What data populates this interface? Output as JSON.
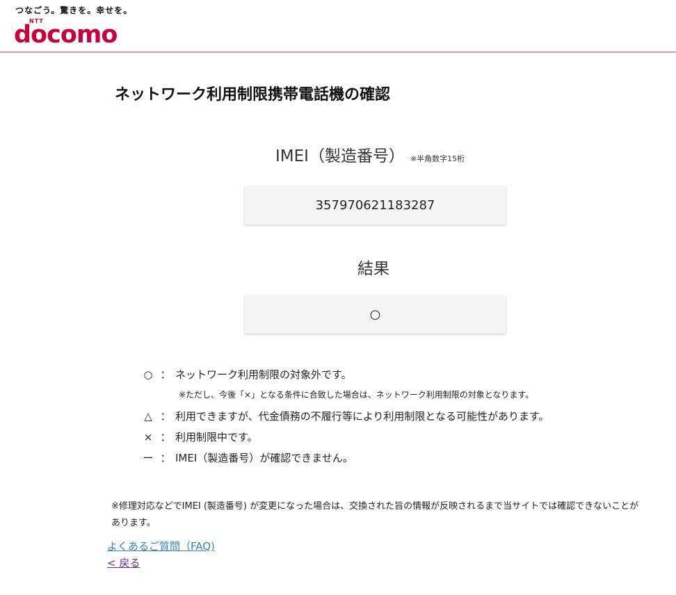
{
  "header": {
    "tagline": "つなごう。驚きを。幸せを。",
    "logo_ntt": "NTT",
    "logo_word": "docomo",
    "brand_color": "#c8003c"
  },
  "page": {
    "title": "ネットワーク利用制限携帯電話機の確認"
  },
  "imei": {
    "label": "IMEI（製造番号）",
    "note": "※半角数字15桁",
    "value": "357970621183287"
  },
  "result": {
    "label": "結果",
    "value": "○"
  },
  "legend": {
    "items": [
      {
        "symbol": "○",
        "colon": "：",
        "text": "ネットワーク利用制限の対象外です。"
      },
      {
        "symbol": "△",
        "colon": "：",
        "text": "利用できますが、代金債務の不履行等により利用制限となる可能性があります。"
      },
      {
        "symbol": "×",
        "colon": "：",
        "text": "利用制限中です。"
      },
      {
        "symbol": "ー",
        "colon": "：",
        "text": "IMEI（製造番号）が確認できません。"
      }
    ],
    "sub_note": "※ただし、今後「×」となる条件に合致した場合は、ネットワーク利用制限の対象となります。"
  },
  "footnote": "※修理対応などでIMEI (製造番号) が変更になった場合は、交換された旨の情報が反映されるまで当サイトでは確認できないことがあります。",
  "links": {
    "faq": "よくあるご質問（FAQ)",
    "back": "< 戻る"
  }
}
